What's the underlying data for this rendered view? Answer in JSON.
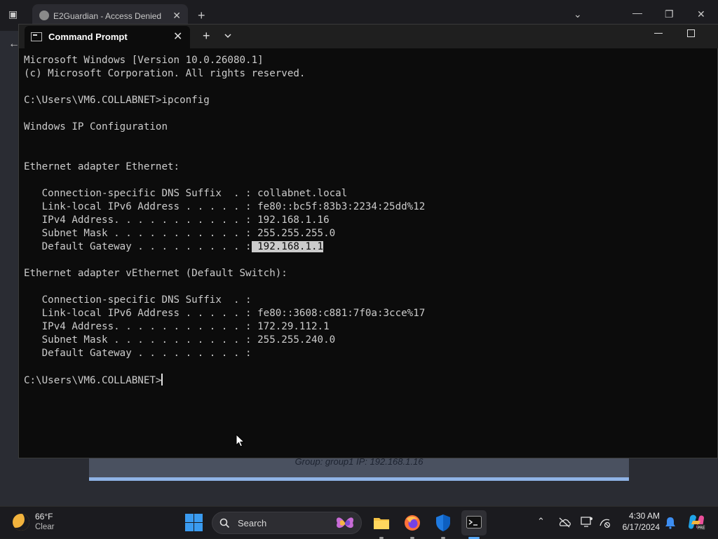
{
  "browser": {
    "tab_title": "E2Guardian - Access Denied",
    "card_text": "Group: group1   IP: 192.168.1.16"
  },
  "terminal": {
    "tab_title": "Command Prompt",
    "lines": [
      "Microsoft Windows [Version 10.0.26080.1]",
      "(c) Microsoft Corporation. All rights reserved.",
      "",
      "C:\\Users\\VM6.COLLABNET>ipconfig",
      "",
      "Windows IP Configuration",
      "",
      "",
      "Ethernet adapter Ethernet:",
      "",
      "   Connection-specific DNS Suffix  . : collabnet.local",
      "   Link-local IPv6 Address . . . . . : fe80::bc5f:83b3:2234:25dd%12",
      "   IPv4 Address. . . . . . . . . . . : 192.168.1.16",
      "   Subnet Mask . . . . . . . . . . . : 255.255.255.0",
      "",
      "",
      "Ethernet adapter vEthernet (Default Switch):",
      "",
      "   Connection-specific DNS Suffix  . :",
      "   Link-local IPv6 Address . . . . . : fe80::3608:c881:7f0a:3cce%17",
      "   IPv4 Address. . . . . . . . . . . : 172.29.112.1",
      "   Subnet Mask . . . . . . . . . . . : 255.255.240.0",
      "   Default Gateway . . . . . . . . . :",
      ""
    ],
    "gateway_label": "   Default Gateway . . . . . . . . . :",
    "gateway_value": " 192.168.1.1",
    "prompt": "C:\\Users\\VM6.COLLABNET>"
  },
  "taskbar": {
    "weather_temp": "66°F",
    "weather_condition": "Clear",
    "search_label": "Search",
    "time": "4:30 AM",
    "date": "6/17/2024"
  },
  "colors": {
    "terminal_bg": "#0c0c0c",
    "terminal_text": "#cccccc",
    "accent": "#5aa9f5"
  }
}
